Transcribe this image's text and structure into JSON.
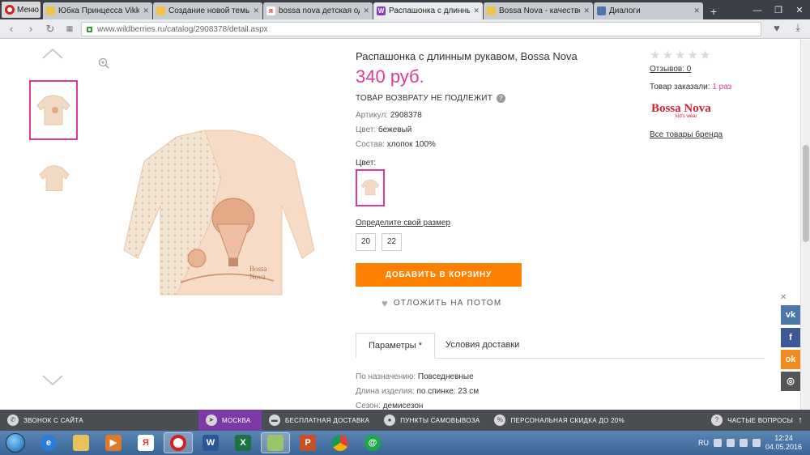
{
  "browser": {
    "menu_label": "Меню",
    "tabs": [
      {
        "title": "Юбка Принцесса Vikki",
        "color": "#f0c24b"
      },
      {
        "title": "Создание новой темы",
        "color": "#f0c24b"
      },
      {
        "title": "bossa nova детская оде",
        "color": "#e0392b"
      },
      {
        "title": "Распашонка с длинным",
        "color": "#8a3ab9"
      },
      {
        "title": "Bossa Nova - качествен",
        "color": "#f0c24b"
      },
      {
        "title": "Диалоги",
        "color": "#4a76a8"
      }
    ],
    "url": "www.wildberries.ru/catalog/2908378/detail.aspx"
  },
  "product": {
    "title": "Распашонка с длинным рукавом, Bossa Nova",
    "price": "340 руб.",
    "no_return": "ТОВАР ВОЗВРАТУ НЕ ПОДЛЕЖИТ",
    "article_label": "Артикул:",
    "article_value": "2908378",
    "color_label": "Цвет:",
    "color_value": "бежевый",
    "composition_label": "Состав:",
    "composition_value": "хлопок 100%",
    "color_picker_label": "Цвет:",
    "size_label": "Определите свой размер",
    "sizes": [
      "20",
      "22"
    ],
    "add_to_cart": "ДОБАВИТЬ В КОРЗИНУ",
    "save_later": "ОТЛОЖИТЬ НА ПОТОМ"
  },
  "tabs": {
    "params": "Параметры *",
    "delivery": "Условия доставки"
  },
  "params": [
    {
      "label": "По назначению:",
      "value": "Повседневные"
    },
    {
      "label": "Длина изделия:",
      "value": "по спинке: 23 см"
    },
    {
      "label": "Сезон:",
      "value": "демисезон"
    }
  ],
  "side": {
    "reviews": "Отзывов: 0",
    "ordered_label": "Товар заказали:",
    "ordered_value": "1 раз",
    "brand_name": "Bossa Nova",
    "brand_sub": "kid's wear",
    "brand_link": "Все товары бренда",
    "rating": 0
  },
  "social": [
    "vk",
    "facebook",
    "odnoklassniki",
    "instagram"
  ],
  "sitebar": {
    "call": "ЗВОНОК С САЙТА",
    "city": "МОСКВА",
    "delivery": "БЕСПЛАТНАЯ ДОСТАВКА",
    "pickup": "ПУНКТЫ САМОВЫВОЗА",
    "discount": "ПЕРСОНАЛЬНАЯ СКИДКА ДО 20%",
    "faq": "ЧАСТЫЕ ВОПРОСЫ"
  },
  "taskbar": {
    "lang": "RU",
    "time": "12:24",
    "date": "04.05.2016"
  },
  "colors": {
    "accent_pink": "#e0399a",
    "cart_orange": "#ff7f00",
    "city_purple": "#7b3aa6"
  }
}
